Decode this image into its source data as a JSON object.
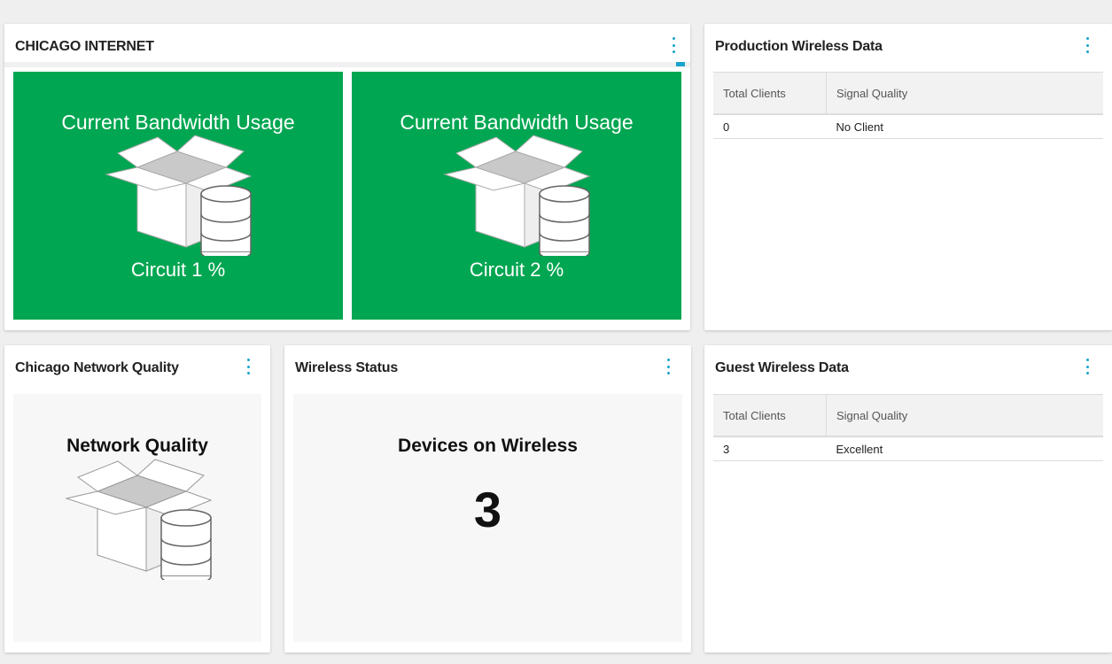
{
  "chicago_internet": {
    "title": "CHICAGO INTERNET",
    "tiles": [
      {
        "title": "Current Bandwidth Usage",
        "subtitle": "Circuit 1 %",
        "icon": "box-database-icon",
        "color": "#00a651"
      },
      {
        "title": "Current Bandwidth Usage",
        "subtitle": "Circuit 2 %",
        "icon": "box-database-icon",
        "color": "#00a651"
      }
    ]
  },
  "production_wireless": {
    "title": "Production Wireless Data",
    "columns": [
      "Total Clients",
      "Signal Quality"
    ],
    "rows": [
      [
        "0",
        "No Client"
      ]
    ]
  },
  "network_quality": {
    "title": "Chicago Network Quality",
    "label": "Network Quality",
    "icon": "box-database-icon"
  },
  "wireless_status": {
    "title": "Wireless Status",
    "label": "Devices on Wireless",
    "value": "3"
  },
  "guest_wireless": {
    "title": "Guest Wireless Data",
    "columns": [
      "Total Clients",
      "Signal Quality"
    ],
    "rows": [
      [
        "3",
        "Excellent"
      ]
    ]
  },
  "colors": {
    "accent": "#1aa3cc",
    "tile_green": "#00a651"
  }
}
